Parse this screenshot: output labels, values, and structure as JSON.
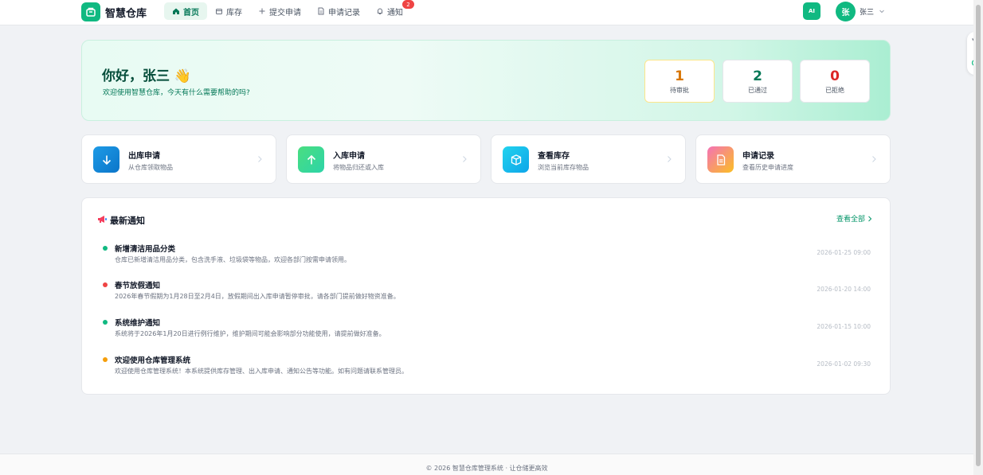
{
  "app": {
    "name": "智慧仓库",
    "accent": "#10b981"
  },
  "nav": {
    "items": [
      {
        "label": "首页",
        "icon": "home-icon",
        "active": true
      },
      {
        "label": "库存",
        "icon": "box-icon"
      },
      {
        "label": "提交申请",
        "icon": "plus-icon"
      },
      {
        "label": "申请记录",
        "icon": "document-icon"
      },
      {
        "label": "通知",
        "icon": "bell-icon",
        "badge": "2"
      }
    ]
  },
  "header": {
    "ai_label": "AI",
    "user_initial": "张",
    "user_name": "张三"
  },
  "banner": {
    "greeting": "你好，张三 👋",
    "subtitle": "欢迎使用智慧仓库，今天有什么需要帮助的吗?",
    "stats": [
      {
        "value": "1",
        "label": "待审批",
        "color": "#d97706"
      },
      {
        "value": "2",
        "label": "已通过",
        "color": "#047857"
      },
      {
        "value": "0",
        "label": "已拒绝",
        "color": "#dc2626"
      }
    ]
  },
  "actions": [
    {
      "title": "出库申请",
      "desc": "从仓库领取物品",
      "icon": "arrow-down-icon"
    },
    {
      "title": "入库申请",
      "desc": "将物品归还或入库",
      "icon": "arrow-up-icon"
    },
    {
      "title": "查看库存",
      "desc": "浏览当前库存物品",
      "icon": "package-icon"
    },
    {
      "title": "申请记录",
      "desc": "查看历史申请进度",
      "icon": "file-icon"
    }
  ],
  "notices": {
    "title": "最新通知",
    "view_all": "查看全部",
    "items": [
      {
        "title": "新增清洁用品分类",
        "desc": "仓库已新增清洁用品分类，包含洗手液、垃圾袋等物品，欢迎各部门按需申请领用。",
        "time": "2026-01-25 09:00",
        "color": "#10b981"
      },
      {
        "title": "春节放假通知",
        "desc": "2026年春节假期为1月28日至2月4日，放假期间出入库申请暂停审批，请各部门提前做好物资准备。",
        "time": "2026-01-20 14:00",
        "color": "#ef4444"
      },
      {
        "title": "系统维护通知",
        "desc": "系统将于2026年1月20日进行例行维护，维护期间可能会影响部分功能使用，请提前做好准备。",
        "time": "2026-01-15 10:00",
        "color": "#10b981"
      },
      {
        "title": "欢迎使用仓库管理系统",
        "desc": "欢迎使用仓库管理系统！本系统提供库存管理、出入库申请、通知公告等功能。如有问题请联系管理员。",
        "time": "2026-01-02 09:30",
        "color": "#f59e0b"
      }
    ]
  },
  "footer": {
    "text": "© 2026 智慧仓库管理系统 · 让仓储更高效"
  }
}
